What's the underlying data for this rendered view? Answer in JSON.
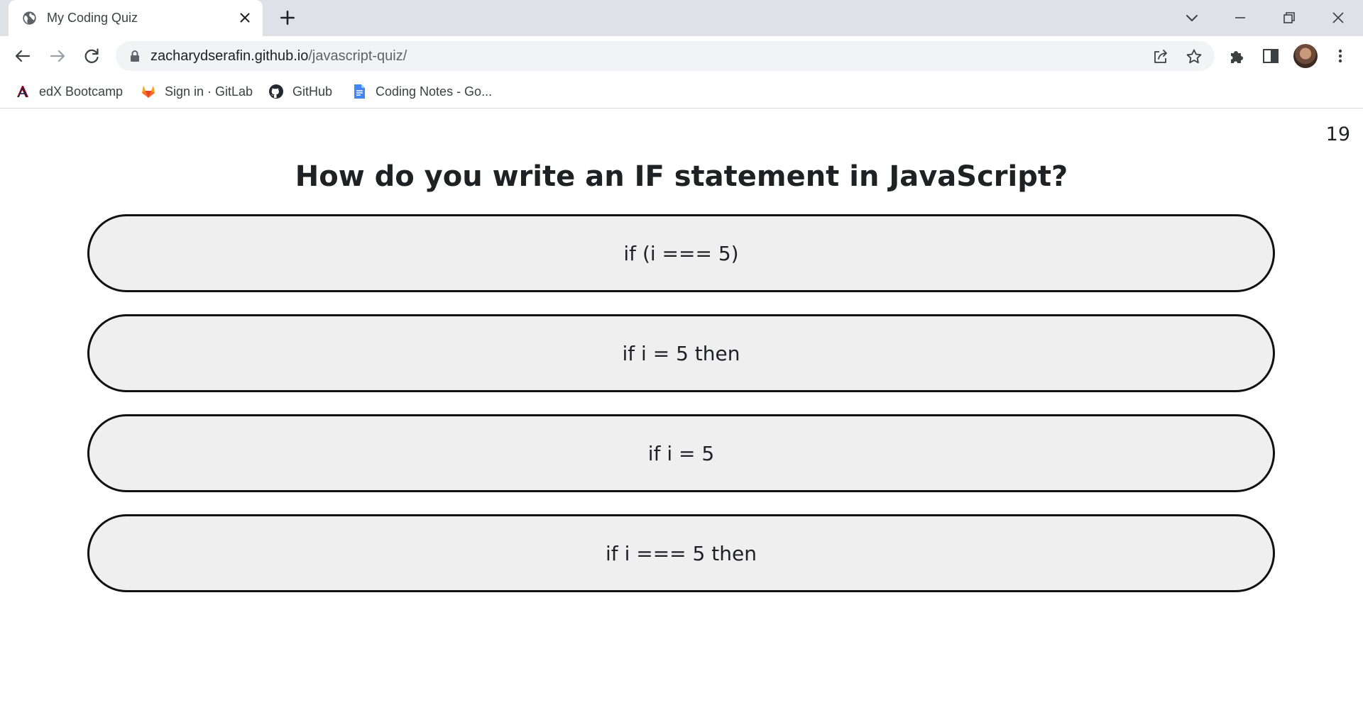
{
  "browser": {
    "tab_title": "My Coding Quiz",
    "url_host": "zacharydserafin.github.io",
    "url_path": "/javascript-quiz/",
    "bookmarks": [
      {
        "label": "edX Bootcamp",
        "icon": "arizona-a-icon"
      },
      {
        "label": "Sign in · GitLab",
        "icon": "gitlab-icon"
      },
      {
        "label": "GitHub",
        "icon": "github-icon"
      },
      {
        "label": "Coding Notes - Go...",
        "icon": "google-docs-icon"
      }
    ]
  },
  "quiz": {
    "timer": "19",
    "question": "How do you write an IF statement in JavaScript?",
    "answers": [
      "if (i === 5)",
      "if i = 5 then",
      "if i = 5",
      "if i === 5 then"
    ]
  }
}
